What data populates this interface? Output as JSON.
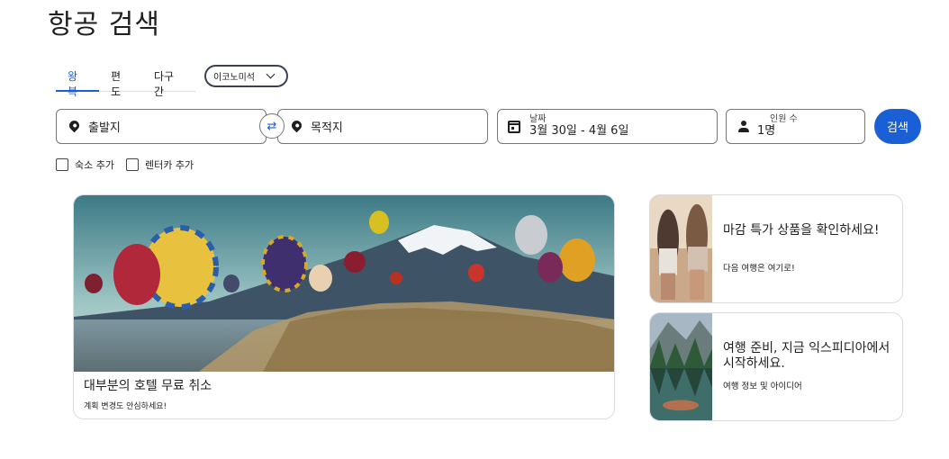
{
  "page": {
    "title": "항공 검색"
  },
  "trip_tabs": [
    {
      "label": "왕복",
      "active": true
    },
    {
      "label": "편도",
      "active": false
    },
    {
      "label": "다구간",
      "active": false
    }
  ],
  "cabin_class": {
    "selected": "이코노미석"
  },
  "search": {
    "origin_placeholder": "출발지",
    "destination_placeholder": "목적지",
    "date_label": "날짜",
    "date_value": "3월 30일 - 4월 6일",
    "travelers_label": "인원 수",
    "travelers_value": "1명",
    "button_label": "검색",
    "icons": {
      "origin": "location-pin-icon",
      "swap": "swap-icon",
      "destination": "location-pin-icon",
      "date": "calendar-icon",
      "travelers": "person-icon"
    }
  },
  "addons": [
    {
      "label": "숙소 추가",
      "checked": false
    },
    {
      "label": "렌터카 추가",
      "checked": false
    }
  ],
  "promos": {
    "hero": {
      "title": "대부분의 호텔 무료 취소",
      "subtitle": "계획 변경도 안심하세요!"
    },
    "cards": [
      {
        "title": "마감 특가 상품을 확인하세요!",
        "subtitle": "다음 여행은 여기로!"
      },
      {
        "title": "여행 준비, 지금 익스피디아에서 시작하세요.",
        "subtitle": "여행 정보 및 아이디어"
      }
    ]
  },
  "colors": {
    "accent": "#1a5fd6",
    "text": "#1f1f1f",
    "border": "#747775"
  }
}
